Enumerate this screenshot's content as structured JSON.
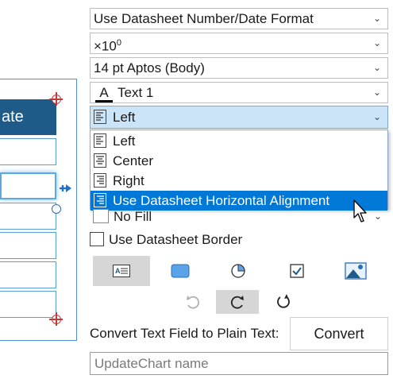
{
  "canvas": {
    "header_text": "ate"
  },
  "panel": {
    "number_format": "Use Datasheet Number/Date Format",
    "scale_base": "×10",
    "scale_exp": "0",
    "font": "14 pt Aptos (Body)",
    "text_color": "Text 1",
    "text_color_glyph": "A",
    "alignment": "Left",
    "alignment_options": [
      "Left",
      "Center",
      "Right",
      "Use Datasheet Horizontal Alignment"
    ],
    "fill": "No Fill",
    "use_border_label": "Use Datasheet Border",
    "convert_label": "Convert Text Field to Plain Text:",
    "convert_button": "Convert",
    "name_placeholder": "UpdateChart name"
  },
  "colors": {
    "header_bg": "#1e5b88",
    "highlight": "#0078d7",
    "dropdown_active": "#cce4f7",
    "handle": "#c23a3a"
  },
  "icons": [
    "chevron-down-icon",
    "align-left-icon",
    "align-center-icon",
    "align-right-icon",
    "datasheet-align-icon",
    "textbox-icon",
    "rounded-rect-icon",
    "pie-icon",
    "checkbox-icon",
    "picture-icon",
    "rotate-left-icon",
    "redo-icon",
    "rotate-right-icon"
  ]
}
